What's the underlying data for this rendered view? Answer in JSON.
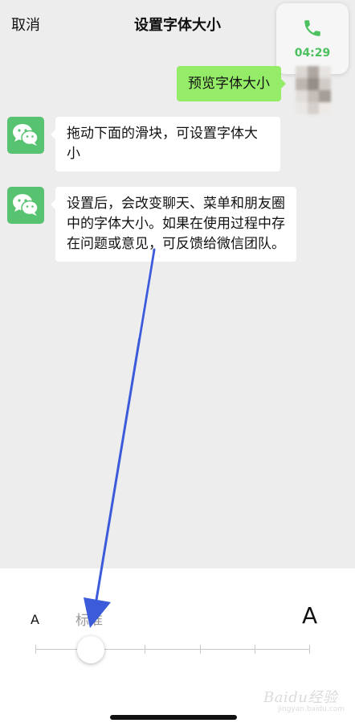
{
  "header": {
    "cancel_label": "取消",
    "title": "设置字体大小"
  },
  "call_widget": {
    "icon": "phone-icon",
    "timer": "04:29",
    "color": "#4cc05f"
  },
  "chat": {
    "sent": {
      "text": "预览字体大小",
      "bubble_color": "#95ec69"
    },
    "received": [
      {
        "avatar_icon": "wechat-logo-icon",
        "text": "拖动下面的滑块，可设置字体大小"
      },
      {
        "avatar_icon": "wechat-logo-icon",
        "text": "设置后，会改变聊天、菜单和朋友圈中的字体大小。如果在使用过程中存在问题或意见，可反馈给微信团队。"
      }
    ]
  },
  "font_slider": {
    "min_label": "A",
    "current_label": "标准",
    "max_label": "A",
    "level": 2,
    "levels": 6
  },
  "watermark": {
    "text": "Baidu经验",
    "subtext": "jingyan.baidu.com"
  },
  "colors": {
    "background": "#ededed",
    "panel": "#ffffff",
    "wechat_green": "#57c26f",
    "annotation_arrow": "#3b5bdb"
  }
}
